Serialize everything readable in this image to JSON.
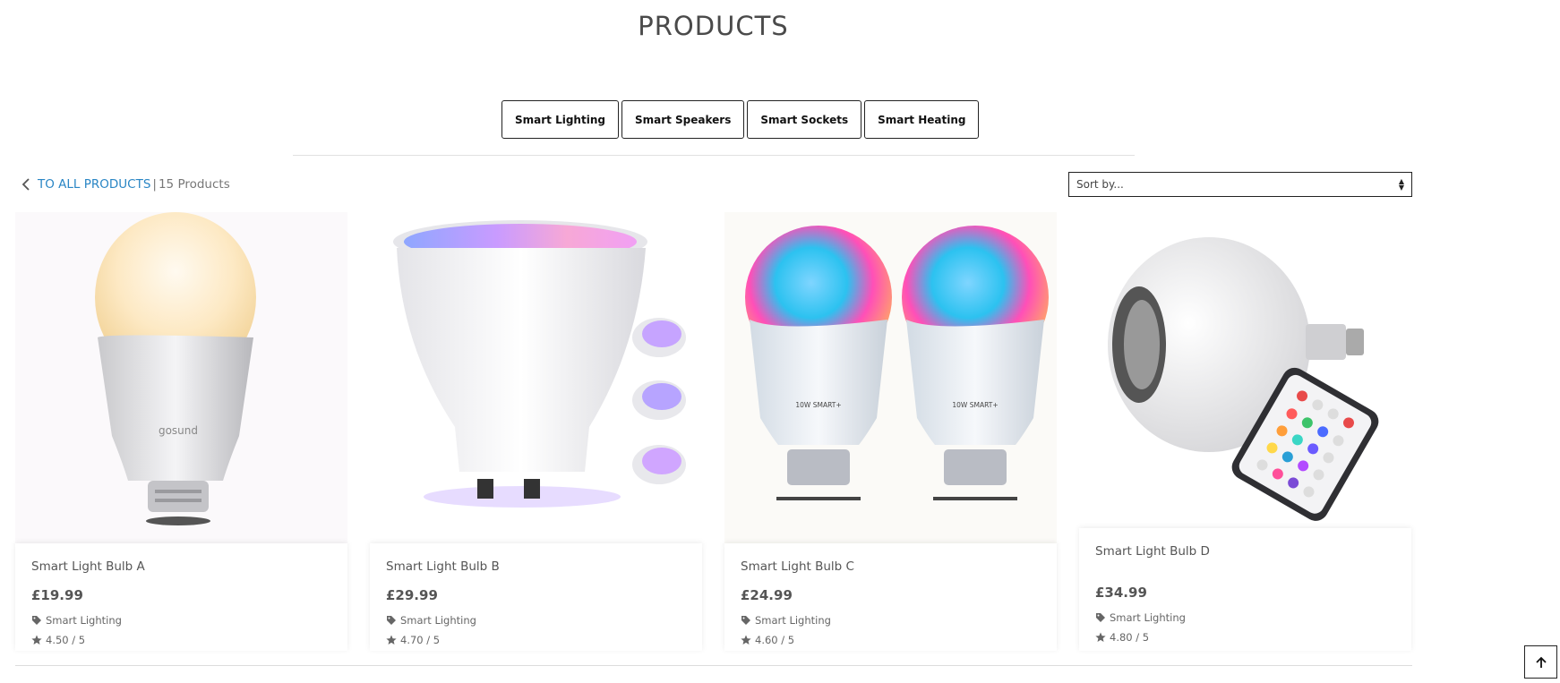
{
  "page": {
    "title": "PRODUCTS"
  },
  "categories": [
    "Smart Lighting",
    "Smart Speakers",
    "Smart Sockets",
    "Smart Heating"
  ],
  "breadcrumb": {
    "back_label": "TO ALL PRODUCTS",
    "separator": "|",
    "count": "15 Products"
  },
  "sort": {
    "placeholder": "Sort by..."
  },
  "products": [
    {
      "name": "Smart Light Bulb A",
      "price": "£19.99",
      "category": "Smart Lighting",
      "rating": "4.50 / 5"
    },
    {
      "name": "Smart Light Bulb B",
      "price": "£29.99",
      "category": "Smart Lighting",
      "rating": "4.70 / 5"
    },
    {
      "name": "Smart Light Bulb C",
      "price": "£24.99",
      "category": "Smart Lighting",
      "rating": "4.60 / 5"
    },
    {
      "name": "Smart Light Bulb D",
      "price": "£34.99",
      "category": "Smart Lighting",
      "rating": "4.80 / 5"
    }
  ],
  "icons": {
    "back": "chevron-left-icon",
    "tag": "tag-icon",
    "rating": "star-icon",
    "scroll_top": "arrow-up-icon",
    "sort": "sort-arrows-icon"
  },
  "colors": {
    "link": "#2a86c5",
    "text": "#555555",
    "border": "#222222"
  }
}
